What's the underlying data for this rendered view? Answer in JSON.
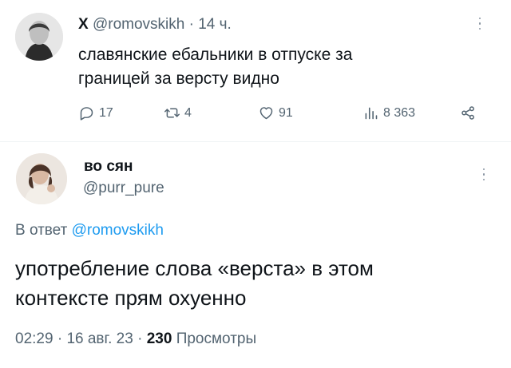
{
  "tweet1": {
    "name": "X",
    "handle": "@romovskikh",
    "separator": "·",
    "time": "14 ч.",
    "text_line1": "славянские ебальники в отпуске за",
    "text_line2": "границей за версту видно",
    "replies": "17",
    "retweets": "4",
    "likes": "91",
    "views": "8 363"
  },
  "tweet2": {
    "name": "во сян",
    "handle": "@purr_pure",
    "reply_prefix": "В ответ",
    "reply_to": "@romovskikh",
    "text_line1": "употребление слова «верста» в этом",
    "text_line2": "контексте прям охуенно",
    "time": "02:29",
    "sep1": "·",
    "date": "16 авг. 23",
    "sep2": "·",
    "views_count": "230",
    "views_label": "Просмотры"
  },
  "icons": {
    "reply": "speech-bubble-icon",
    "retweet": "retweet-arrows-icon",
    "like": "heart-icon",
    "views": "bar-chart-icon",
    "share": "share-icon",
    "more": "vertical-dots-icon"
  },
  "colors": {
    "link": "#1d9bf0",
    "muted": "#536471",
    "text": "#0f1419"
  }
}
